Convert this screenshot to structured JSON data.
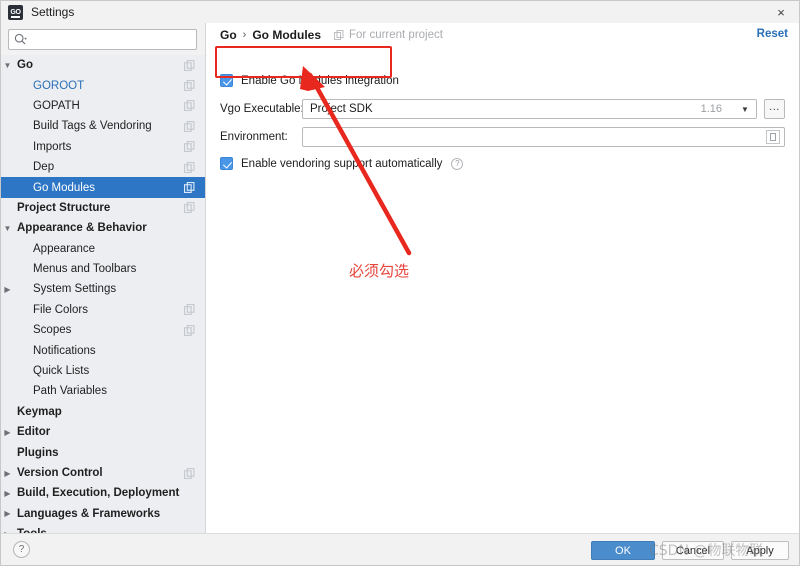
{
  "window": {
    "title": "Settings",
    "app_icon": "goland-icon",
    "close_label": "×"
  },
  "search": {
    "value": "",
    "placeholder": "",
    "icon": "search-icon"
  },
  "sidebar": {
    "items": [
      {
        "label": "Go",
        "depth": 0,
        "bold": true,
        "blue": false,
        "twisty": "down",
        "scope_icon": true,
        "selected": false
      },
      {
        "label": "GOROOT",
        "depth": 1,
        "bold": false,
        "blue": true,
        "twisty": "",
        "scope_icon": true,
        "selected": false
      },
      {
        "label": "GOPATH",
        "depth": 1,
        "bold": false,
        "blue": false,
        "twisty": "",
        "scope_icon": true,
        "selected": false
      },
      {
        "label": "Build Tags & Vendoring",
        "depth": 1,
        "bold": false,
        "blue": false,
        "twisty": "",
        "scope_icon": true,
        "selected": false
      },
      {
        "label": "Imports",
        "depth": 1,
        "bold": false,
        "blue": false,
        "twisty": "",
        "scope_icon": true,
        "selected": false
      },
      {
        "label": "Dep",
        "depth": 1,
        "bold": false,
        "blue": false,
        "twisty": "",
        "scope_icon": true,
        "selected": false
      },
      {
        "label": "Go Modules",
        "depth": 1,
        "bold": false,
        "blue": false,
        "twisty": "",
        "scope_icon": true,
        "selected": true
      },
      {
        "label": "Project Structure",
        "depth": 0,
        "bold": true,
        "blue": false,
        "twisty": "",
        "scope_icon": true,
        "selected": false
      },
      {
        "label": "Appearance & Behavior",
        "depth": 0,
        "bold": true,
        "blue": false,
        "twisty": "down",
        "scope_icon": false,
        "selected": false
      },
      {
        "label": "Appearance",
        "depth": 1,
        "bold": false,
        "blue": false,
        "twisty": "",
        "scope_icon": false,
        "selected": false
      },
      {
        "label": "Menus and Toolbars",
        "depth": 1,
        "bold": false,
        "blue": false,
        "twisty": "",
        "scope_icon": false,
        "selected": false
      },
      {
        "label": "System Settings",
        "depth": 1,
        "bold": false,
        "blue": false,
        "twisty": "right",
        "scope_icon": false,
        "selected": false
      },
      {
        "label": "File Colors",
        "depth": 1,
        "bold": false,
        "blue": false,
        "twisty": "",
        "scope_icon": true,
        "selected": false
      },
      {
        "label": "Scopes",
        "depth": 1,
        "bold": false,
        "blue": false,
        "twisty": "",
        "scope_icon": true,
        "selected": false
      },
      {
        "label": "Notifications",
        "depth": 1,
        "bold": false,
        "blue": false,
        "twisty": "",
        "scope_icon": false,
        "selected": false
      },
      {
        "label": "Quick Lists",
        "depth": 1,
        "bold": false,
        "blue": false,
        "twisty": "",
        "scope_icon": false,
        "selected": false
      },
      {
        "label": "Path Variables",
        "depth": 1,
        "bold": false,
        "blue": false,
        "twisty": "",
        "scope_icon": false,
        "selected": false
      },
      {
        "label": "Keymap",
        "depth": 0,
        "bold": true,
        "blue": false,
        "twisty": "",
        "scope_icon": false,
        "selected": false
      },
      {
        "label": "Editor",
        "depth": 0,
        "bold": true,
        "blue": false,
        "twisty": "right",
        "scope_icon": false,
        "selected": false
      },
      {
        "label": "Plugins",
        "depth": 0,
        "bold": true,
        "blue": false,
        "twisty": "",
        "scope_icon": false,
        "selected": false
      },
      {
        "label": "Version Control",
        "depth": 0,
        "bold": true,
        "blue": false,
        "twisty": "right",
        "scope_icon": true,
        "selected": false
      },
      {
        "label": "Build, Execution, Deployment",
        "depth": 0,
        "bold": true,
        "blue": false,
        "twisty": "right",
        "scope_icon": false,
        "selected": false
      },
      {
        "label": "Languages & Frameworks",
        "depth": 0,
        "bold": true,
        "blue": false,
        "twisty": "right",
        "scope_icon": false,
        "selected": false
      },
      {
        "label": "Tools",
        "depth": 0,
        "bold": true,
        "blue": false,
        "twisty": "right",
        "scope_icon": false,
        "selected": false
      }
    ]
  },
  "main": {
    "breadcrumb": {
      "root": "Go",
      "separator": "›",
      "current": "Go Modules"
    },
    "scope_note": "For current project",
    "reset_label": "Reset",
    "enable_modules": {
      "label": "Enable Go Modules integration",
      "checked": true
    },
    "vgo": {
      "label": "Vgo Executable:",
      "value": "Project SDK",
      "version": "1.16",
      "browse_label": "...",
      "caret": "▼"
    },
    "environment": {
      "label": "Environment:",
      "value": ""
    },
    "vendoring": {
      "label": "Enable vendoring support automatically",
      "checked": true,
      "help": "?"
    }
  },
  "footer": {
    "help": "?",
    "ok_label": "OK",
    "cancel_label": "Cancel",
    "apply_label": "Apply"
  },
  "annotations": {
    "note_text": "必须勾选",
    "highlight_color": "#e8281e",
    "arrow_color": "#e8281e",
    "watermark": "CSDN @物联物联"
  }
}
